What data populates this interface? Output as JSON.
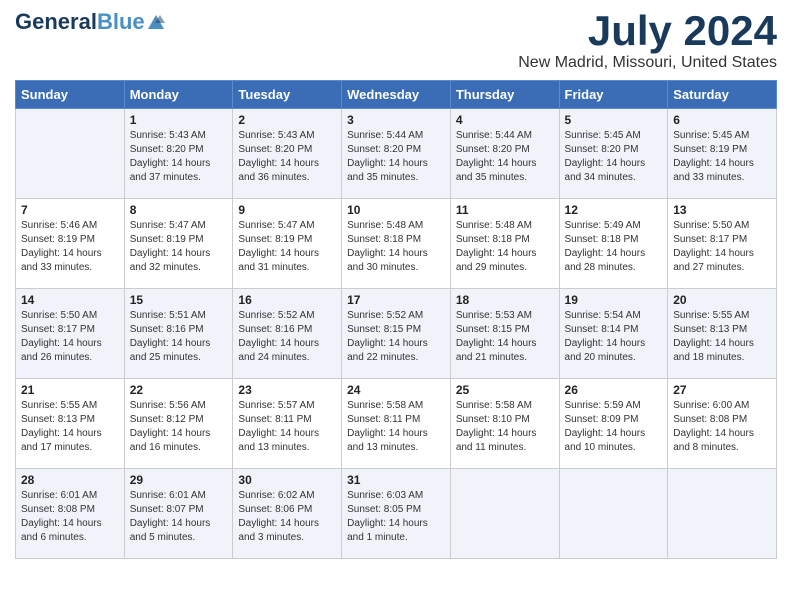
{
  "header": {
    "logo_line1": "General",
    "logo_line2": "Blue",
    "month": "July 2024",
    "location": "New Madrid, Missouri, United States"
  },
  "days_of_week": [
    "Sunday",
    "Monday",
    "Tuesday",
    "Wednesday",
    "Thursday",
    "Friday",
    "Saturday"
  ],
  "weeks": [
    [
      {
        "day": "",
        "info": ""
      },
      {
        "day": "1",
        "info": "Sunrise: 5:43 AM\nSunset: 8:20 PM\nDaylight: 14 hours\nand 37 minutes."
      },
      {
        "day": "2",
        "info": "Sunrise: 5:43 AM\nSunset: 8:20 PM\nDaylight: 14 hours\nand 36 minutes."
      },
      {
        "day": "3",
        "info": "Sunrise: 5:44 AM\nSunset: 8:20 PM\nDaylight: 14 hours\nand 35 minutes."
      },
      {
        "day": "4",
        "info": "Sunrise: 5:44 AM\nSunset: 8:20 PM\nDaylight: 14 hours\nand 35 minutes."
      },
      {
        "day": "5",
        "info": "Sunrise: 5:45 AM\nSunset: 8:20 PM\nDaylight: 14 hours\nand 34 minutes."
      },
      {
        "day": "6",
        "info": "Sunrise: 5:45 AM\nSunset: 8:19 PM\nDaylight: 14 hours\nand 33 minutes."
      }
    ],
    [
      {
        "day": "7",
        "info": "Sunrise: 5:46 AM\nSunset: 8:19 PM\nDaylight: 14 hours\nand 33 minutes."
      },
      {
        "day": "8",
        "info": "Sunrise: 5:47 AM\nSunset: 8:19 PM\nDaylight: 14 hours\nand 32 minutes."
      },
      {
        "day": "9",
        "info": "Sunrise: 5:47 AM\nSunset: 8:19 PM\nDaylight: 14 hours\nand 31 minutes."
      },
      {
        "day": "10",
        "info": "Sunrise: 5:48 AM\nSunset: 8:18 PM\nDaylight: 14 hours\nand 30 minutes."
      },
      {
        "day": "11",
        "info": "Sunrise: 5:48 AM\nSunset: 8:18 PM\nDaylight: 14 hours\nand 29 minutes."
      },
      {
        "day": "12",
        "info": "Sunrise: 5:49 AM\nSunset: 8:18 PM\nDaylight: 14 hours\nand 28 minutes."
      },
      {
        "day": "13",
        "info": "Sunrise: 5:50 AM\nSunset: 8:17 PM\nDaylight: 14 hours\nand 27 minutes."
      }
    ],
    [
      {
        "day": "14",
        "info": "Sunrise: 5:50 AM\nSunset: 8:17 PM\nDaylight: 14 hours\nand 26 minutes."
      },
      {
        "day": "15",
        "info": "Sunrise: 5:51 AM\nSunset: 8:16 PM\nDaylight: 14 hours\nand 25 minutes."
      },
      {
        "day": "16",
        "info": "Sunrise: 5:52 AM\nSunset: 8:16 PM\nDaylight: 14 hours\nand 24 minutes."
      },
      {
        "day": "17",
        "info": "Sunrise: 5:52 AM\nSunset: 8:15 PM\nDaylight: 14 hours\nand 22 minutes."
      },
      {
        "day": "18",
        "info": "Sunrise: 5:53 AM\nSunset: 8:15 PM\nDaylight: 14 hours\nand 21 minutes."
      },
      {
        "day": "19",
        "info": "Sunrise: 5:54 AM\nSunset: 8:14 PM\nDaylight: 14 hours\nand 20 minutes."
      },
      {
        "day": "20",
        "info": "Sunrise: 5:55 AM\nSunset: 8:13 PM\nDaylight: 14 hours\nand 18 minutes."
      }
    ],
    [
      {
        "day": "21",
        "info": "Sunrise: 5:55 AM\nSunset: 8:13 PM\nDaylight: 14 hours\nand 17 minutes."
      },
      {
        "day": "22",
        "info": "Sunrise: 5:56 AM\nSunset: 8:12 PM\nDaylight: 14 hours\nand 16 minutes."
      },
      {
        "day": "23",
        "info": "Sunrise: 5:57 AM\nSunset: 8:11 PM\nDaylight: 14 hours\nand 13 minutes."
      },
      {
        "day": "24",
        "info": "Sunrise: 5:58 AM\nSunset: 8:11 PM\nDaylight: 14 hours\nand 13 minutes."
      },
      {
        "day": "25",
        "info": "Sunrise: 5:58 AM\nSunset: 8:10 PM\nDaylight: 14 hours\nand 11 minutes."
      },
      {
        "day": "26",
        "info": "Sunrise: 5:59 AM\nSunset: 8:09 PM\nDaylight: 14 hours\nand 10 minutes."
      },
      {
        "day": "27",
        "info": "Sunrise: 6:00 AM\nSunset: 8:08 PM\nDaylight: 14 hours\nand 8 minutes."
      }
    ],
    [
      {
        "day": "28",
        "info": "Sunrise: 6:01 AM\nSunset: 8:08 PM\nDaylight: 14 hours\nand 6 minutes."
      },
      {
        "day": "29",
        "info": "Sunrise: 6:01 AM\nSunset: 8:07 PM\nDaylight: 14 hours\nand 5 minutes."
      },
      {
        "day": "30",
        "info": "Sunrise: 6:02 AM\nSunset: 8:06 PM\nDaylight: 14 hours\nand 3 minutes."
      },
      {
        "day": "31",
        "info": "Sunrise: 6:03 AM\nSunset: 8:05 PM\nDaylight: 14 hours\nand 1 minute."
      },
      {
        "day": "",
        "info": ""
      },
      {
        "day": "",
        "info": ""
      },
      {
        "day": "",
        "info": ""
      }
    ]
  ]
}
